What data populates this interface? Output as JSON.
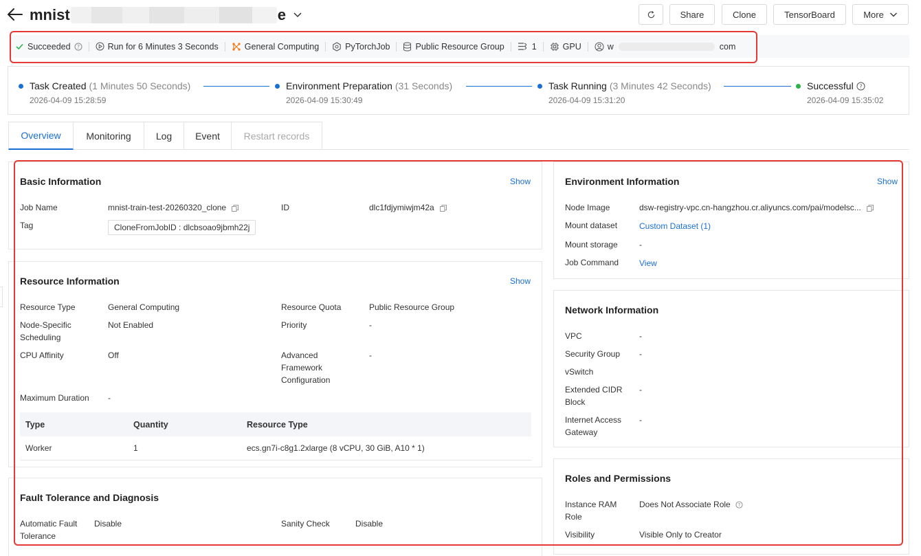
{
  "header": {
    "title_prefix": "mnist",
    "title_suffix": "e",
    "buttons": {
      "share": "Share",
      "clone": "Clone",
      "tensorboard": "TensorBoard",
      "more": "More"
    }
  },
  "status_bar": {
    "state": "Succeeded",
    "run_time": "Run for 6 Minutes 3 Seconds",
    "resource_type": "General Computing",
    "framework": "PyTorchJob",
    "resource_group": "Public Resource Group",
    "node_count": "1",
    "gpu": "GPU",
    "user_prefix": "w",
    "user_suffix": "com"
  },
  "timeline": [
    {
      "title": "Task Created",
      "duration": "(1 Minutes 50 Seconds)",
      "time": "2026-04-09 15:28:59"
    },
    {
      "title": "Environment Preparation",
      "duration": "(31 Seconds)",
      "time": "2026-04-09 15:30:49"
    },
    {
      "title": "Task Running",
      "duration": "(3 Minutes 42 Seconds)",
      "time": "2026-04-09 15:31:20"
    },
    {
      "title": "Successful",
      "duration": "",
      "time": "2026-04-09 15:35:02"
    }
  ],
  "tabs": [
    "Overview",
    "Monitoring",
    "Log",
    "Event",
    "Restart records"
  ],
  "show_label": "Show",
  "basic": {
    "title": "Basic Information",
    "job_name_label": "Job Name",
    "job_name": "mnist-train-test-20260320_clone",
    "id_label": "ID",
    "id": "dlc1fdjymiwjm42a",
    "tag_label": "Tag",
    "tag": "CloneFromJobID : dlcbsoao9jbmh22j"
  },
  "resource": {
    "title": "Resource Information",
    "resource_type_label": "Resource Type",
    "resource_type": "General Computing",
    "quota_label": "Resource Quota",
    "quota": "Public Resource Group",
    "node_sched_label_1": "Node-Specific",
    "node_sched_label_2": "Scheduling",
    "node_sched": "Not Enabled",
    "priority_label": "Priority",
    "priority": "-",
    "cpu_aff_label": "CPU Affinity",
    "cpu_aff": "Off",
    "adv_label_1": "Advanced",
    "adv_label_2": "Framework",
    "adv_label_3": "Configuration",
    "adv": "-",
    "max_dur_label": "Maximum Duration",
    "max_dur": "-",
    "table": {
      "headers": [
        "Type",
        "Quantity",
        "Resource Type"
      ],
      "rows": [
        [
          "Worker",
          "1",
          "ecs.gn7i-c8g1.2xlarge (8 vCPU, 30 GiB, A10 * 1)"
        ]
      ]
    }
  },
  "fault": {
    "title": "Fault Tolerance and Diagnosis",
    "auto_label_1": "Automatic Fault",
    "auto_label_2": "Tolerance",
    "auto": "Disable",
    "sanity_label": "Sanity Check",
    "sanity": "Disable"
  },
  "env": {
    "title": "Environment Information",
    "node_image_label": "Node Image",
    "node_image": "dsw-registry-vpc.cn-hangzhou.cr.aliyuncs.com/pai/modelsc...",
    "mount_dataset_label": "Mount dataset",
    "mount_dataset": "Custom Dataset (1)",
    "mount_storage_label": "Mount storage",
    "mount_storage": "-",
    "job_cmd_label": "Job Command",
    "job_cmd": "View"
  },
  "network": {
    "title": "Network Information",
    "vpc_label": "VPC",
    "vpc": "-",
    "sg_label": "Security Group",
    "sg": "-",
    "vswitch_label": "vSwitch",
    "cidr_label_1": "Extended CIDR",
    "cidr_label_2": "Block",
    "cidr": "-",
    "gw_label_1": "Internet Access",
    "gw_label_2": "Gateway",
    "gw": "-"
  },
  "roles": {
    "title": "Roles and Permissions",
    "ram_label_1": "Instance RAM",
    "ram_label_2": "Role",
    "ram": "Does Not Associate Role",
    "vis_label": "Visibility",
    "vis": "Visible Only to Creator"
  }
}
